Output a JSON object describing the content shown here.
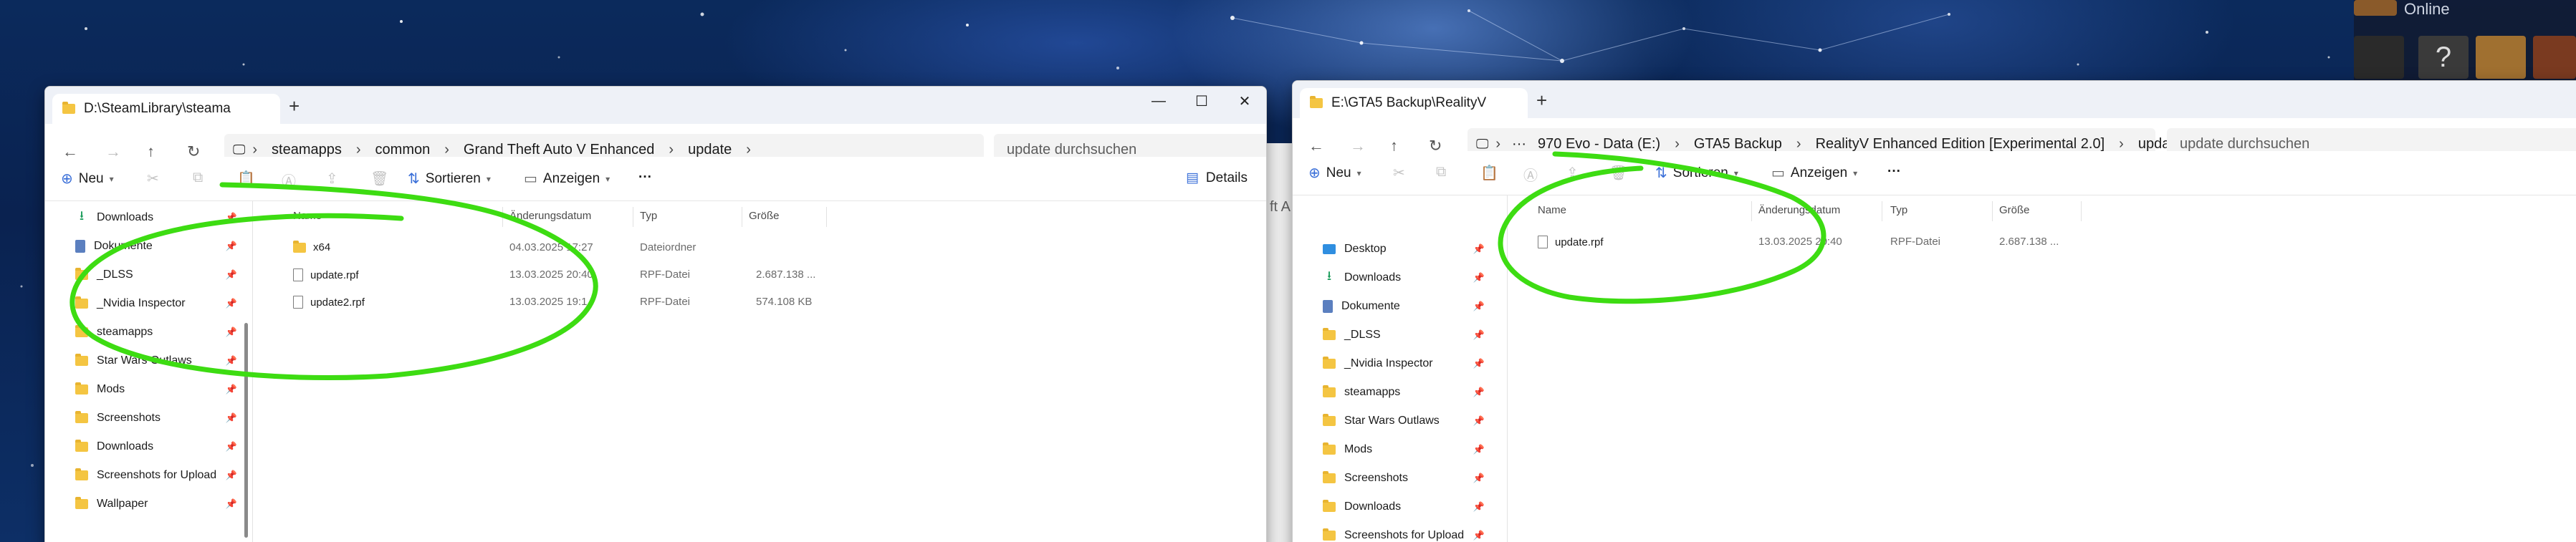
{
  "tray": {
    "online_label": "Online"
  },
  "left_window": {
    "tab_title": "D:\\SteamLibrary\\steama",
    "breadcrumb": [
      "steamapps",
      "common",
      "Grand Theft Auto V Enhanced",
      "update"
    ],
    "search_placeholder": "update durchsuchen",
    "toolbar": {
      "new_label": "Neu",
      "sort_label": "Sortieren",
      "view_label": "Anzeigen",
      "more_label": "···",
      "details_label": "Details"
    },
    "sidebar": [
      {
        "label": "Downloads",
        "icon": "download-icon"
      },
      {
        "label": "Dokumente",
        "icon": "document-icon"
      },
      {
        "label": "_DLSS",
        "icon": "folder-icon"
      },
      {
        "label": "_Nvidia Inspector",
        "icon": "folder-icon"
      },
      {
        "label": "steamapps",
        "icon": "folder-icon"
      },
      {
        "label": "Star Wars Outlaws",
        "icon": "folder-icon"
      },
      {
        "label": "Mods",
        "icon": "folder-icon"
      },
      {
        "label": "Screenshots",
        "icon": "folder-icon"
      },
      {
        "label": "Downloads",
        "icon": "folder-icon"
      },
      {
        "label": "Screenshots for Upload",
        "icon": "folder-icon"
      },
      {
        "label": "Wallpaper",
        "icon": "folder-icon"
      }
    ],
    "columns": [
      "Name",
      "Änderungsdatum",
      "Typ",
      "Größe"
    ],
    "rows": [
      {
        "name": "x64",
        "date": "04.03.2025 17:27",
        "type": "Dateiordner",
        "size": "",
        "icon": "folder-icon"
      },
      {
        "name": "update.rpf",
        "date": "13.03.2025 20:40",
        "type": "RPF-Datei",
        "size": "2.687.138 ...",
        "icon": "file-icon"
      },
      {
        "name": "update2.rpf",
        "date": "13.03.2025 19:1",
        "type": "RPF-Datei",
        "size": "574.108 KB",
        "icon": "file-icon"
      }
    ]
  },
  "right_window": {
    "tab_title": "E:\\GTA5 Backup\\RealityV",
    "breadcrumb": [
      "970 Evo - Data (E:)",
      "GTA5 Backup",
      "RealityV Enhanced Edition [Experimental 2.0]",
      "update"
    ],
    "search_placeholder": "update durchsuchen",
    "toolbar": {
      "new_label": "Neu",
      "sort_label": "Sortieren",
      "view_label": "Anzeigen",
      "more_label": "···"
    },
    "sidebar": [
      {
        "label": "Desktop",
        "icon": "desktop-icon"
      },
      {
        "label": "Downloads",
        "icon": "download-icon"
      },
      {
        "label": "Dokumente",
        "icon": "document-icon"
      },
      {
        "label": "_DLSS",
        "icon": "folder-icon"
      },
      {
        "label": "_Nvidia Inspector",
        "icon": "folder-icon"
      },
      {
        "label": "steamapps",
        "icon": "folder-icon"
      },
      {
        "label": "Star Wars Outlaws",
        "icon": "folder-icon"
      },
      {
        "label": "Mods",
        "icon": "folder-icon"
      },
      {
        "label": "Screenshots",
        "icon": "folder-icon"
      },
      {
        "label": "Downloads",
        "icon": "folder-icon"
      },
      {
        "label": "Screenshots for Upload",
        "icon": "folder-icon"
      }
    ],
    "columns": [
      "Name",
      "Änderungsdatum",
      "Typ",
      "Größe"
    ],
    "rows": [
      {
        "name": "update.rpf",
        "date": "13.03.2025 20:40",
        "type": "RPF-Datei",
        "size": "2.687.138 ...",
        "icon": "file-icon"
      }
    ]
  },
  "behind_window": {
    "text": "ft A"
  },
  "annotation": {
    "color": "#3ddc12"
  }
}
